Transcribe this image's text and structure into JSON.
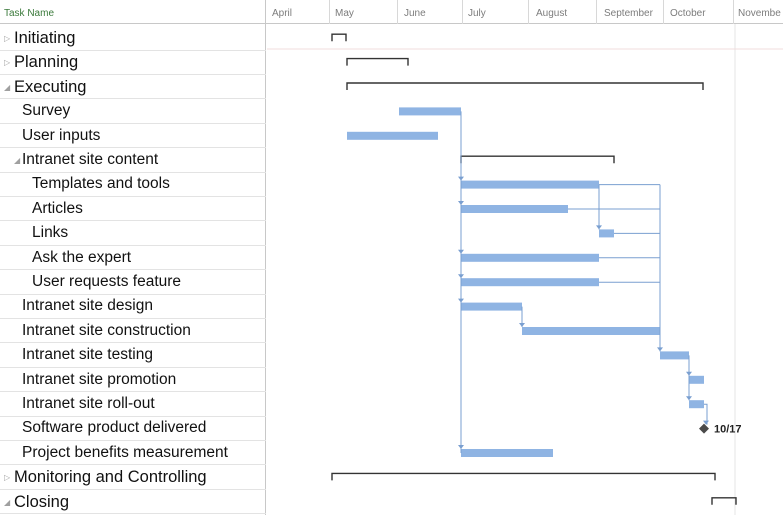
{
  "grid": {
    "header": "Task Name"
  },
  "timescale": {
    "months": [
      "April",
      "May",
      "June",
      "July",
      "August",
      "September",
      "October",
      "Novembe"
    ]
  },
  "tasks": [
    {
      "name": "Initiating",
      "level": 1,
      "state": "collapsed"
    },
    {
      "name": "Planning",
      "level": 1,
      "state": "collapsed"
    },
    {
      "name": "Executing",
      "level": 1,
      "state": "expanded"
    },
    {
      "name": "Survey",
      "level": 2,
      "state": "none"
    },
    {
      "name": "User inputs",
      "level": 2,
      "state": "none"
    },
    {
      "name": "Intranet site content",
      "level": 2,
      "state": "expanded"
    },
    {
      "name": "Templates and tools",
      "level": 3,
      "state": "none"
    },
    {
      "name": "Articles",
      "level": 3,
      "state": "none"
    },
    {
      "name": "Links",
      "level": 3,
      "state": "none"
    },
    {
      "name": "Ask the expert",
      "level": 3,
      "state": "none"
    },
    {
      "name": "User requests feature",
      "level": 3,
      "state": "none"
    },
    {
      "name": "Intranet site design",
      "level": 2,
      "state": "none"
    },
    {
      "name": "Intranet site construction",
      "level": 2,
      "state": "none"
    },
    {
      "name": "Intranet site testing",
      "level": 2,
      "state": "none"
    },
    {
      "name": "Intranet site promotion",
      "level": 2,
      "state": "none"
    },
    {
      "name": "Intranet site roll-out",
      "level": 2,
      "state": "none"
    },
    {
      "name": "Software product delivered",
      "level": 2,
      "state": "none"
    },
    {
      "name": "Project benefits measurement",
      "level": 2,
      "state": "none"
    },
    {
      "name": "Monitoring and Controlling",
      "level": 1,
      "state": "collapsed"
    },
    {
      "name": "Closing",
      "level": 1,
      "state": "expanded"
    }
  ],
  "milestone": {
    "label": "10/17"
  },
  "colors": {
    "bar": "#8fb4e3",
    "link": "#7a9fd0",
    "summary": "#333333",
    "header_text": "#3b7a3b"
  }
}
